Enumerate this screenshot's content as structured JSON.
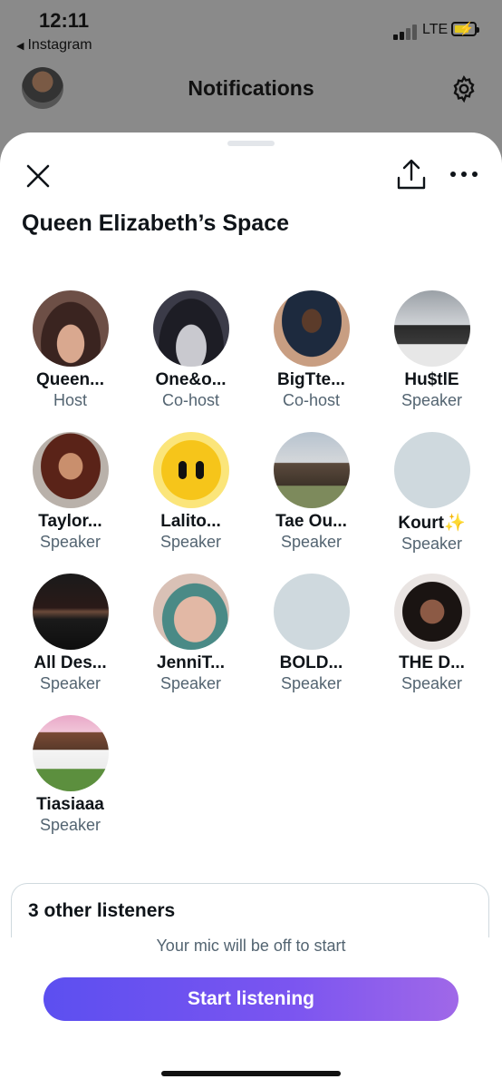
{
  "status": {
    "time": "12:11",
    "back_app": "Instagram",
    "network": "LTE"
  },
  "nav": {
    "title": "Notifications"
  },
  "space": {
    "title": "Queen Elizabeth’s Space"
  },
  "participants": [
    {
      "name": "Queen...",
      "role": "Host",
      "avatar": "photo"
    },
    {
      "name": "One&o...",
      "role": "Co-host",
      "avatar": "photo"
    },
    {
      "name": "BigTte...",
      "role": "Co-host",
      "avatar": "photo"
    },
    {
      "name": "Hu$tlE",
      "role": "Speaker",
      "avatar": "photo"
    },
    {
      "name": "Taylor...",
      "role": "Speaker",
      "avatar": "photo"
    },
    {
      "name": "Lalito...",
      "role": "Speaker",
      "avatar": "star-icon"
    },
    {
      "name": "Tae Ou...",
      "role": "Speaker",
      "avatar": "photo"
    },
    {
      "name": "Kourt✨",
      "role": "Speaker",
      "avatar": "default"
    },
    {
      "name": "All Des...",
      "role": "Speaker",
      "avatar": "photo"
    },
    {
      "name": "JenniT...",
      "role": "Speaker",
      "avatar": "photo"
    },
    {
      "name": "BOLD...",
      "role": "Speaker",
      "avatar": "default"
    },
    {
      "name": "THE D...",
      "role": "Speaker",
      "avatar": "photo"
    },
    {
      "name": "Tiasiaaa",
      "role": "Speaker",
      "avatar": "photo"
    }
  ],
  "listeners": {
    "label": "3 other listeners"
  },
  "mic_note": "Your mic will be off to start",
  "start_button": "Start listening",
  "colors": {
    "accent_start": "#5c4ff0",
    "accent_end": "#a068e8",
    "secondary_text": "#536471",
    "default_avatar": "#cfd9de"
  }
}
